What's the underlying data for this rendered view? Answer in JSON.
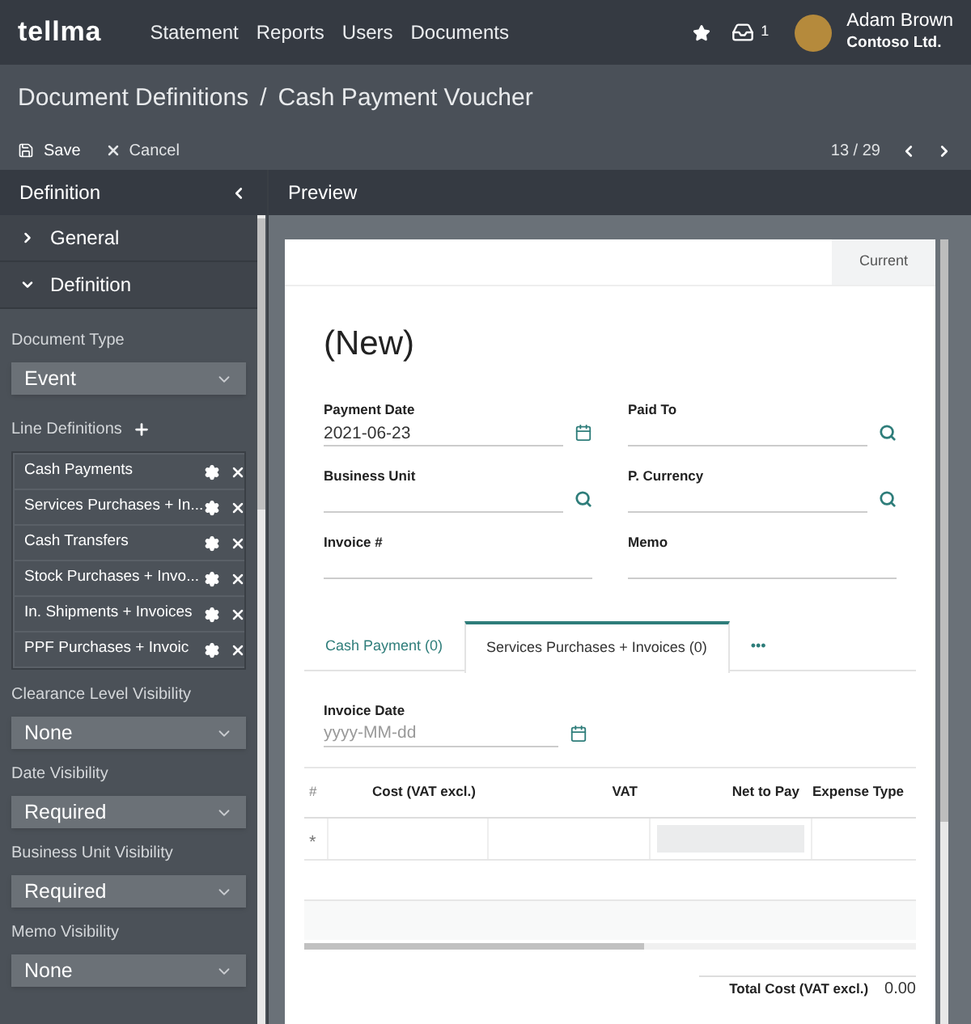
{
  "topbar": {
    "logo": "tellma",
    "nav": [
      "Statement",
      "Reports",
      "Users",
      "Documents"
    ],
    "inbox_count": "1",
    "user_name": "Adam Brown",
    "company": "Contoso Ltd."
  },
  "breadcrumb": {
    "parent": "Document Definitions",
    "separator": "/",
    "current": "Cash Payment Voucher"
  },
  "toolbar": {
    "save": "Save",
    "cancel": "Cancel",
    "pager": "13 / 29"
  },
  "sidebar": {
    "title": "Definition",
    "sections": [
      {
        "label": "General",
        "expanded": false
      },
      {
        "label": "Definition",
        "expanded": true
      }
    ],
    "document_type": {
      "label": "Document Type",
      "value": "Event"
    },
    "line_definitions": {
      "label": "Line Definitions",
      "items": [
        "Cash Payments",
        "Services Purchases + In...",
        "Cash Transfers",
        "Stock Purchases + Invo...",
        "In. Shipments + Invoices",
        "PPF Purchases + Invoic"
      ]
    },
    "visibility": [
      {
        "label": "Clearance Level Visibility",
        "value": "None"
      },
      {
        "label": "Date Visibility",
        "value": "Required"
      },
      {
        "label": "Business Unit Visibility",
        "value": "Required"
      },
      {
        "label": "Memo Visibility",
        "value": "None"
      }
    ]
  },
  "preview": {
    "title": "Preview",
    "state": "Current",
    "heading": "(New)",
    "fields": [
      {
        "label": "Payment Date",
        "value": "2021-06-23",
        "kind": "date"
      },
      {
        "label": "Paid To",
        "kind": "lookup"
      },
      {
        "label": "Business Unit",
        "kind": "lookup"
      },
      {
        "label": "P. Currency",
        "kind": "lookup"
      },
      {
        "label": "Invoice #",
        "kind": "text"
      },
      {
        "label": "Memo",
        "kind": "text"
      }
    ],
    "tabs": [
      {
        "label": "Cash Payment (0)",
        "selected": false
      },
      {
        "label": "Services Purchases + Invoices (0)",
        "selected": true
      },
      {
        "label": "•••",
        "selected": false
      }
    ],
    "invoice_date": {
      "label": "Invoice Date",
      "placeholder": "yyyy-MM-dd"
    },
    "table": {
      "columns": [
        "#",
        "Cost (VAT excl.)",
        "VAT",
        "Net to Pay",
        "Expense Type"
      ],
      "new_row_marker": "*"
    },
    "total": {
      "label": "Total Cost (VAT excl.)",
      "value": "0.00"
    }
  }
}
